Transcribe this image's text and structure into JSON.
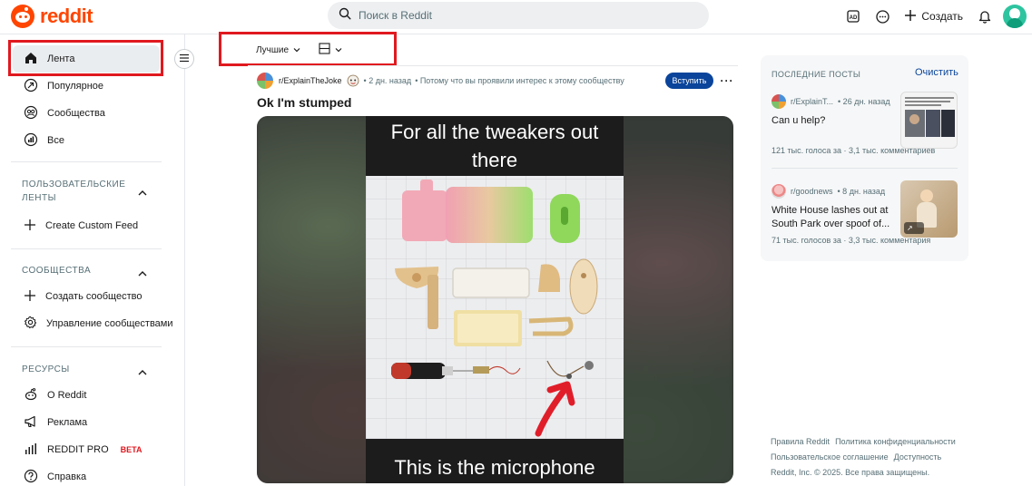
{
  "header": {
    "logo_text": "reddit",
    "search_placeholder": "Поиск в Reddit",
    "create_label": "Создать",
    "brand_color": "#ff4500"
  },
  "sidebar": {
    "main_items": [
      {
        "label": "Лента",
        "icon": "home-icon",
        "active": true
      },
      {
        "label": "Популярное",
        "icon": "popular-icon"
      },
      {
        "label": "Сообщества",
        "icon": "communities-icon"
      },
      {
        "label": "Все",
        "icon": "all-icon"
      }
    ],
    "custom_feeds": {
      "title": "ПОЛЬЗОВАТЕЛЬСКИЕ ЛЕНТЫ",
      "items": [
        {
          "label": "Create Custom Feed",
          "icon": "plus-icon"
        }
      ]
    },
    "communities": {
      "title": "СООБЩЕСТВА",
      "items": [
        {
          "label": "Создать сообщество",
          "icon": "plus-icon"
        },
        {
          "label": "Управление сообществами",
          "icon": "gear-icon"
        }
      ]
    },
    "resources": {
      "title": "РЕСУРСЫ",
      "items": [
        {
          "label": "О Reddit",
          "icon": "reddit-icon"
        },
        {
          "label": "Реклама",
          "icon": "megaphone-icon"
        },
        {
          "label": "REDDIT PRO",
          "icon": "bar-chart-icon",
          "badge": "BETA"
        },
        {
          "label": "Справка",
          "icon": "help-icon"
        }
      ]
    }
  },
  "feed": {
    "sort_label": "Лучшие",
    "post": {
      "subreddit": "r/ExplainTheJoke",
      "time": "• 2 дн. назад",
      "reason": "• Потому что вы проявили интерес к этому сообществу",
      "join_label": "Вступить",
      "title": "Ok I'm stumped",
      "caption_top": "For all the tweakers out there",
      "caption_bottom": "This is the microphone"
    }
  },
  "recent_posts": {
    "title": "ПОСЛЕДНИЕ ПОСТЫ",
    "clear_label": "Очистить",
    "items": [
      {
        "subreddit": "r/ExplainT...",
        "time": "• 26 дн. назад",
        "title": "Can u help?",
        "stats": "121 тыс. голоса за  ·  3,1 тыс. комментариев"
      },
      {
        "subreddit": "r/goodnews",
        "time": "• 8 дн. назад",
        "title": "White House lashes out at South Park over spoof of...",
        "stats": "71 тыс. голосов за  ·  3,3 тыс. комментария"
      }
    ]
  },
  "footer": {
    "links": [
      "Правила Reddit",
      "Политика конфиденциальности",
      "Пользовательское соглашение",
      "Доступность"
    ],
    "copyright": "Reddit, Inc. © 2025. Все права защищены."
  }
}
